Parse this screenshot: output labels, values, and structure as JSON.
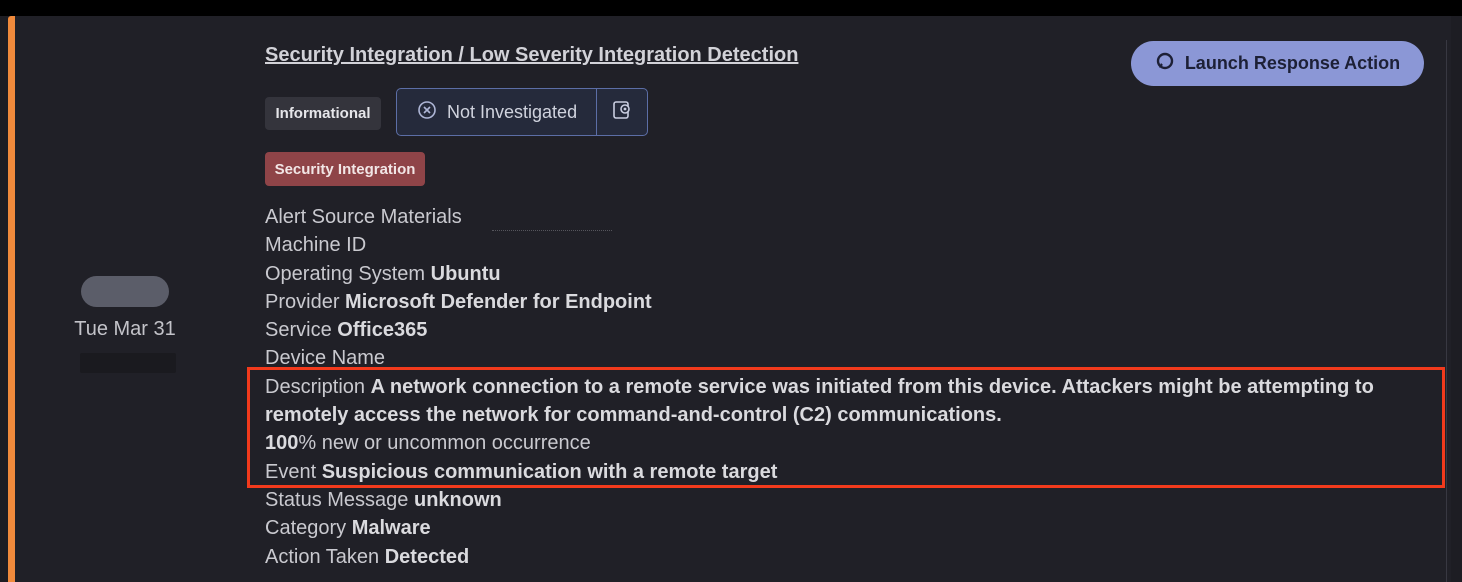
{
  "alert": {
    "title": "Security Integration / Low Severity Integration Detection",
    "date": "Tue Mar 31",
    "severity_label": "Informational",
    "status_label": "Not Investigated",
    "category_tag": "Security Integration",
    "launch_button": "Launch Response Action"
  },
  "details": {
    "alert_source_label": "Alert Source Materials",
    "machine_id_label": "Machine ID",
    "os_label": "Operating System",
    "os_value": "Ubuntu",
    "provider_label": "Provider",
    "provider_value": "Microsoft Defender for Endpoint",
    "service_label": "Service",
    "service_value": "Office365",
    "device_name_label": "Device Name",
    "description_label": "Description",
    "description_value": "A network connection to a remote service was initiated from this device. Attackers might be attempting to remotely access the network for command-and-control (C2) communications.",
    "occurrence_value": "100",
    "occurrence_label": "% new or uncommon occurrence",
    "event_label": "Event",
    "event_value": "Suspicious communication with a remote target",
    "status_message_label": "Status Message",
    "status_message_value": "unknown",
    "category_label": "Category",
    "category_value": "Malware",
    "action_taken_label": "Action Taken",
    "action_taken_value": "Detected"
  },
  "colors": {
    "accent": "#f08a3c",
    "launch_button_bg": "#8b97d6",
    "security_tag_bg": "#8f4448",
    "highlight_box": "#f23a1c"
  },
  "icons": {
    "launch": "chat-bubble-icon",
    "status": "circle-x-icon",
    "status_settings": "settings-gear-icon"
  }
}
